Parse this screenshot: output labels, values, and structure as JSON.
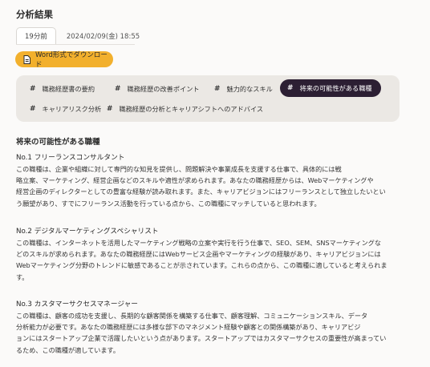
{
  "page": {
    "title": "分析結果"
  },
  "meta": {
    "relative_time": "19分前",
    "date": "2024/02/09(金) 18:55"
  },
  "download": {
    "label": "Word形式でダウンロード",
    "icon": "document-icon"
  },
  "tabs": [
    {
      "label": "職務経歴書の要約",
      "active": false
    },
    {
      "label": "職務経歴の改善ポイント",
      "active": false
    },
    {
      "label": "魅力的なスキル",
      "active": false
    },
    {
      "label": "将来の可能性がある職種",
      "active": true
    },
    {
      "label": "キャリアリスク分析",
      "active": false
    },
    {
      "label": "職務経歴の分析とキャリアシフトへのアドバイス",
      "active": false
    }
  ],
  "content": {
    "heading": "将来の可能性がある職種",
    "careers": [
      {
        "title": "No.1 フリーランスコンサルタント",
        "lines": [
          "この職種は、企業や組織に対して専門的な知見を提供し、問題解決や事業成長を支援する仕事で、具体的には戦",
          "略立案、マーケティング、経営企画などのスキルや適性が求められます。あなたの職務経歴からは、Webマーケティングや",
          "経営企画のディレクターとしての豊富な経験が読み取れます。また、キャリアビジョンにはフリーランスとして独立したいとい",
          "う願望があり、すでにフリーランス活動を行っている点から、この職種にマッチしていると思われます。"
        ]
      },
      {
        "title": "No.2 デジタルマーケティングスペシャリスト",
        "lines": [
          "この職種は、インターネットを活用したマーケティング戦略の立案や実行を行う仕事で、SEO、SEM、SNSマーケティングな",
          "どのスキルが求められます。あなたの職務経歴にはWebサービス企画やマーケティングの経験があり、キャリアビジョンには",
          "Webマーケティング分野のトレンドに敏感であることが示されています。これらの点から、この職種に適していると考えられま",
          "す。"
        ]
      },
      {
        "title": "No.3 カスタマーサクセスマネージャー",
        "lines": [
          "この職種は、顧客の成功を支援し、長期的な顧客関係を構築する仕事で、顧客理解、コミュニケーションスキル、データ",
          "分析能力が必要です。あなたの職務経歴には多様な部下のマネジメント経験や顧客との関係構築があり、キャリアビジ",
          "ョンにはスタートアップ企業で活躍したいという点があります。スタートアップではカスタマーサクセスの重要性が高まってい",
          "るため、この職種が適しています。"
        ]
      }
    ]
  }
}
